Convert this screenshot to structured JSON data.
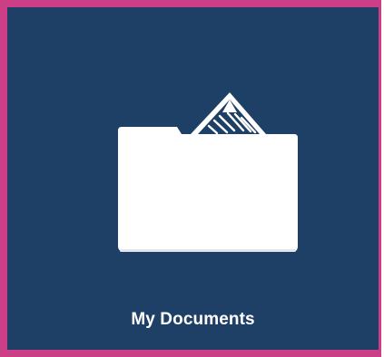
{
  "tile": {
    "label": "My Documents",
    "background_color": "#1e3f66",
    "border_color": "#cc3f87",
    "icon": "folder-with-documents-icon"
  }
}
